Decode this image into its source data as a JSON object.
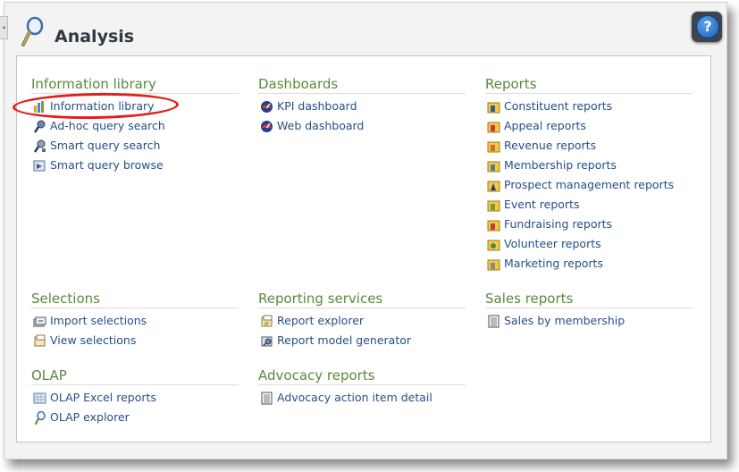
{
  "header": {
    "title": "Analysis"
  },
  "help": {
    "label": "?"
  },
  "sections": [
    {
      "id": "information-library",
      "title": "Information library",
      "items": [
        {
          "label": "Information library",
          "icon": "information-library-icon"
        },
        {
          "label": "Ad-hoc query search",
          "icon": "adhoc-query-icon"
        },
        {
          "label": "Smart query search",
          "icon": "smart-query-icon"
        },
        {
          "label": "Smart query browse",
          "icon": "smart-query-browse-icon"
        }
      ]
    },
    {
      "id": "dashboards",
      "title": "Dashboards",
      "items": [
        {
          "label": "KPI dashboard",
          "icon": "dashboard-icon"
        },
        {
          "label": "Web dashboard",
          "icon": "dashboard-icon"
        }
      ]
    },
    {
      "id": "reports",
      "title": "Reports",
      "items": [
        {
          "label": "Constituent reports",
          "icon": "report-folder-icon"
        },
        {
          "label": "Appeal reports",
          "icon": "report-folder-icon"
        },
        {
          "label": "Revenue reports",
          "icon": "report-folder-icon"
        },
        {
          "label": "Membership reports",
          "icon": "report-folder-icon"
        },
        {
          "label": "Prospect management reports",
          "icon": "report-folder-icon"
        },
        {
          "label": "Event reports",
          "icon": "report-folder-icon"
        },
        {
          "label": "Fundraising reports",
          "icon": "report-folder-icon"
        },
        {
          "label": "Volunteer reports",
          "icon": "report-folder-icon"
        },
        {
          "label": "Marketing reports",
          "icon": "report-folder-icon"
        }
      ]
    },
    {
      "id": "selections",
      "title": "Selections",
      "items": [
        {
          "label": "Import selections",
          "icon": "import-selections-icon"
        },
        {
          "label": "View selections",
          "icon": "view-selections-icon"
        }
      ]
    },
    {
      "id": "reporting-services",
      "title": "Reporting services",
      "items": [
        {
          "label": "Report explorer",
          "icon": "report-explorer-icon"
        },
        {
          "label": "Report model generator",
          "icon": "report-model-icon"
        }
      ]
    },
    {
      "id": "sales-reports",
      "title": "Sales reports",
      "items": [
        {
          "label": "Sales by membership",
          "icon": "document-icon"
        }
      ]
    },
    {
      "id": "olap",
      "title": "OLAP",
      "items": [
        {
          "label": "OLAP Excel reports",
          "icon": "excel-report-icon"
        },
        {
          "label": "OLAP explorer",
          "icon": "magnifier-icon"
        }
      ]
    },
    {
      "id": "advocacy-reports",
      "title": "Advocacy reports",
      "items": [
        {
          "label": "Advocacy action item detail",
          "icon": "document-icon"
        }
      ]
    }
  ]
}
